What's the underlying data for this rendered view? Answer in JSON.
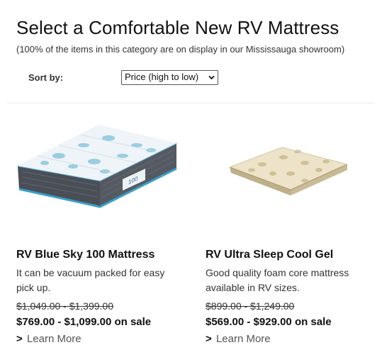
{
  "header": {
    "title": "Select a Comfortable New RV Mattress",
    "subtitle": "(100% of the items in this category are on display in our Mississauga showroom)"
  },
  "sort": {
    "label": "Sort by:",
    "selected": "Price (high to low)"
  },
  "products": [
    {
      "name": "RV Blue Sky 100 Mattress",
      "description": "It can be vacuum packed for easy pick up.",
      "old_price": "$1,049.00 - $1,399.00",
      "sale_price": "$769.00 - $1,099.00 on sale",
      "link_prefix": ">",
      "link_label": "Learn More",
      "image_label": "100"
    },
    {
      "name": "RV Ultra Sleep Cool Gel",
      "description": "Good quality foam core mattress available in RV sizes.",
      "old_price": "$899.00 - $1,249.00",
      "sale_price": "$569.00 - $929.00 on sale",
      "link_prefix": ">",
      "link_label": "Learn More"
    }
  ]
}
